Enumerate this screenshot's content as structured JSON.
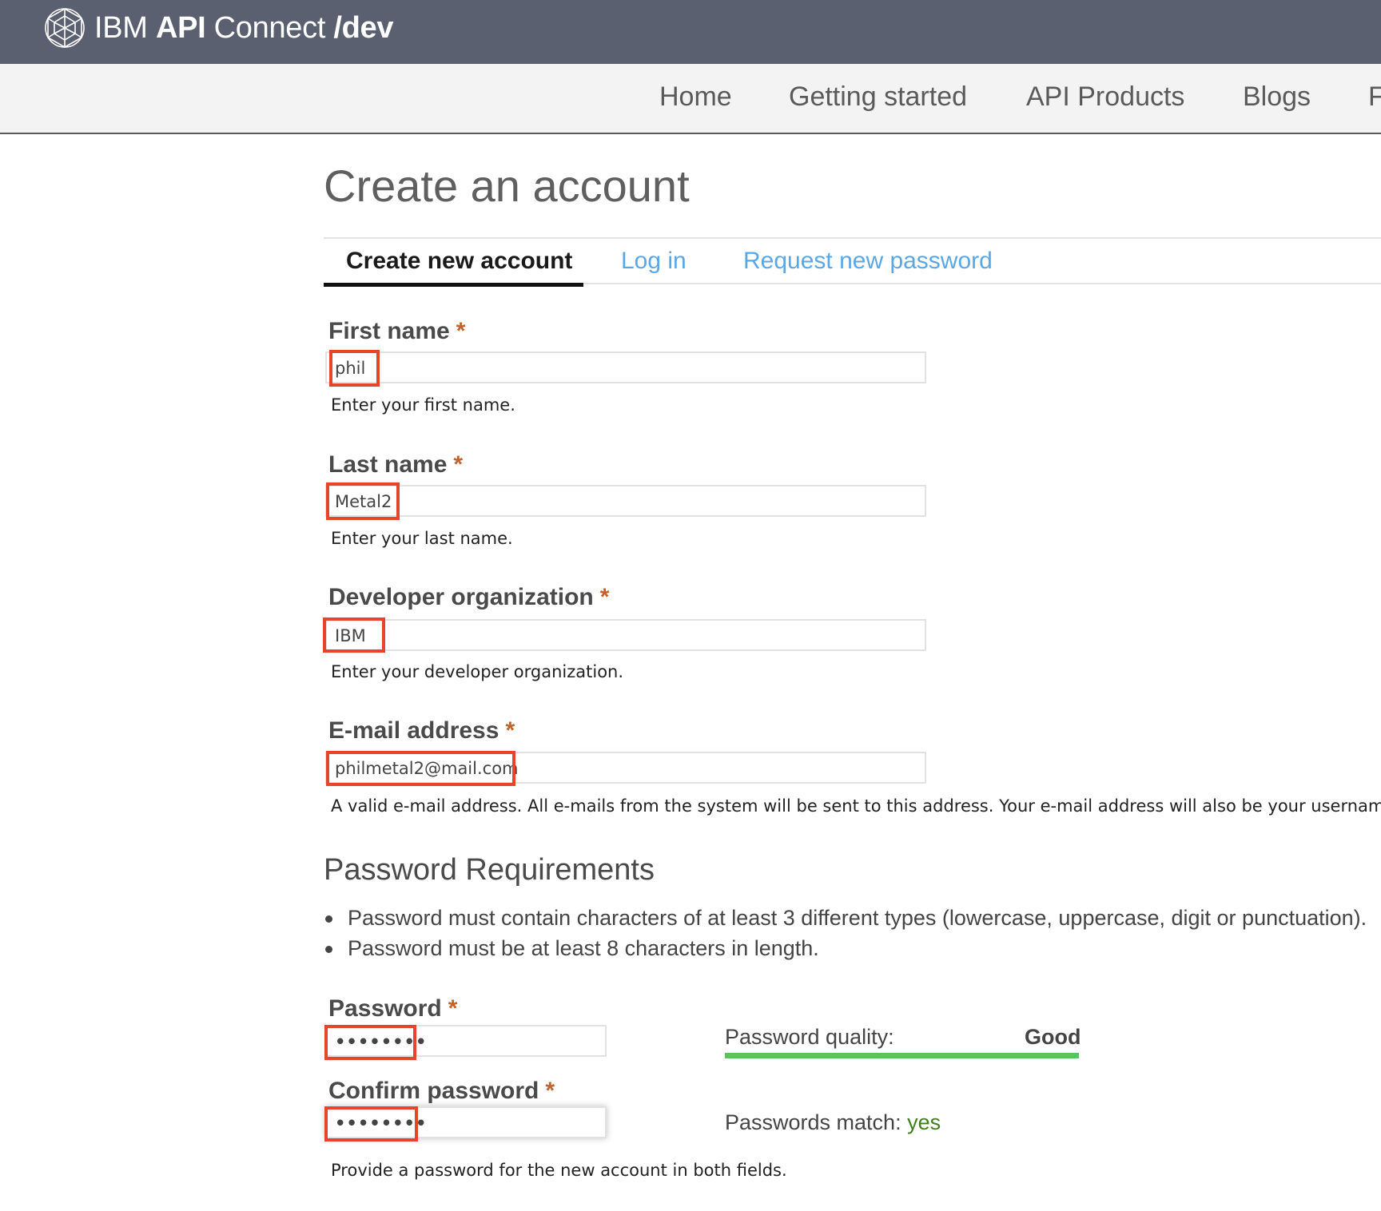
{
  "header": {
    "brand_prefix": "IBM",
    "brand_bold": "API",
    "brand_mid": "Connect",
    "brand_path": "/dev",
    "logo_icon": "ibm-api-connect-sphere-icon",
    "bg_color": "#5a6070"
  },
  "nav": {
    "items": [
      "Home",
      "Getting started",
      "API Products",
      "Blogs",
      "F"
    ]
  },
  "page": {
    "title": "Create an account"
  },
  "tabs": [
    {
      "label": "Create new account",
      "active": true
    },
    {
      "label": "Log in",
      "active": false
    },
    {
      "label": "Request new password",
      "active": false
    }
  ],
  "form": {
    "required_marker": "*",
    "first_name": {
      "label": "First name",
      "value": "phil",
      "help": "Enter your first name."
    },
    "last_name": {
      "label": "Last name",
      "value": "Metal2",
      "help": "Enter your last name."
    },
    "organization": {
      "label": "Developer organization",
      "value": "IBM",
      "help": "Enter your developer organization."
    },
    "email": {
      "label": "E-mail address",
      "value": "philmetal2@mail.com",
      "help": "A valid e-mail address. All e-mails from the system will be sent to this address. Your e-mail address will also be your username."
    },
    "password_section": {
      "title": "Password Requirements",
      "requirements": [
        "Password must contain characters of at least 3 different types (lowercase, uppercase, digit or punctuation).",
        "Password must be at least 8 characters in length."
      ]
    },
    "password": {
      "label": "Password",
      "value": "••••••••"
    },
    "confirm_password": {
      "label": "Confirm password",
      "value": "••••••••"
    },
    "password_quality": {
      "label": "Password quality:",
      "value": "Good",
      "level": 1.0,
      "color": "#5cc15e"
    },
    "passwords_match": {
      "label": "Passwords match:",
      "value": "yes"
    },
    "password_help": "Provide a password for the new account in both fields."
  },
  "colors": {
    "highlight_box": "#e5452b",
    "required": "#c0642b",
    "tab_link": "#5aa7e6"
  }
}
